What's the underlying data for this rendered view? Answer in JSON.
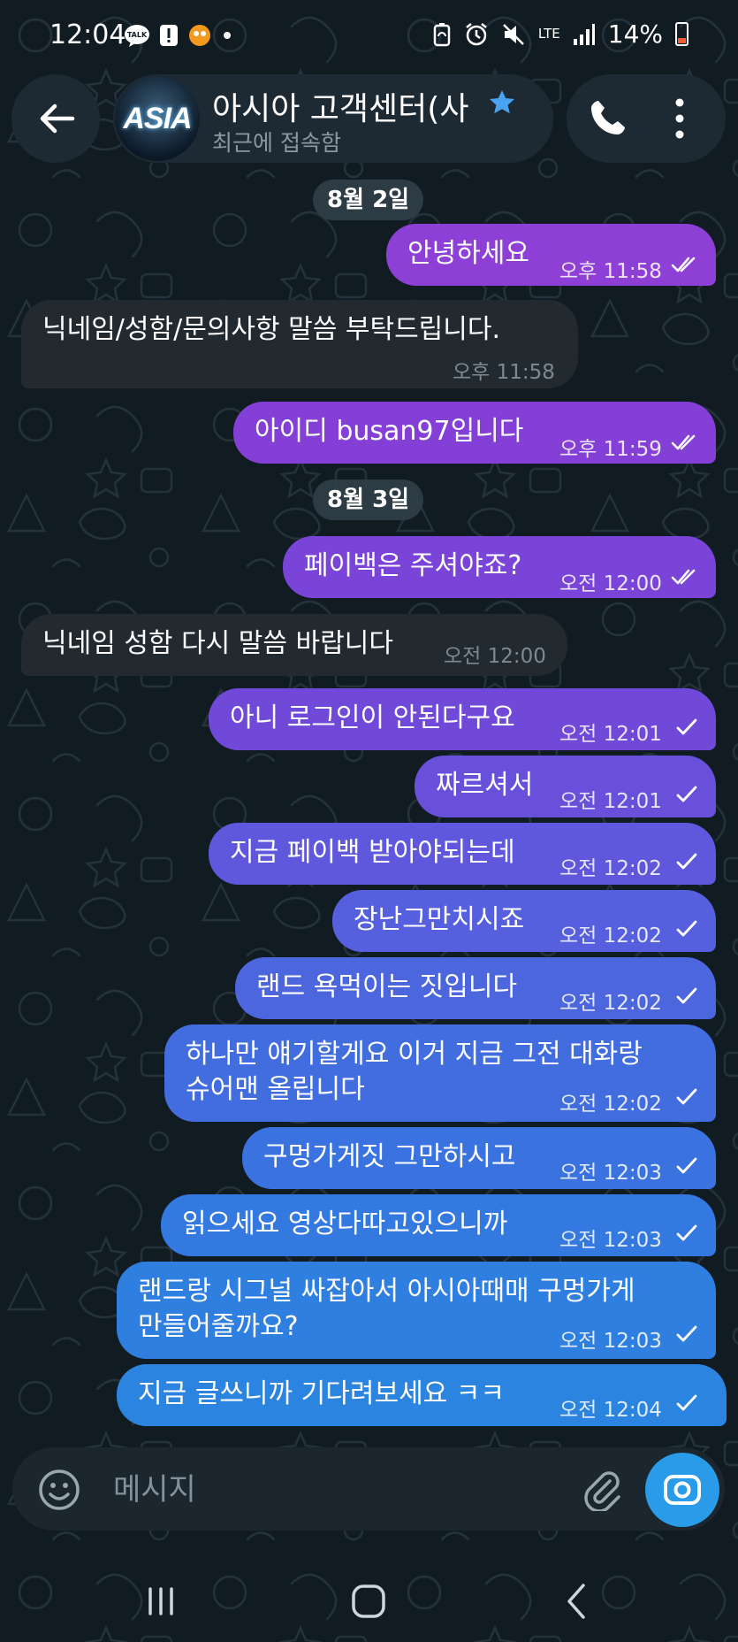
{
  "status_bar": {
    "time": "12:04",
    "network": "LTE",
    "battery": "14%"
  },
  "header": {
    "title": "아시아 고객센터(사",
    "status": "최근에 접속함",
    "avatar_text": "ASIA"
  },
  "colors": {
    "background": "#111b22",
    "incoming_bubble": "#222a30",
    "outgoing_purple": "#8e3fd6",
    "outgoing_blue": "#2f7fe0",
    "accent": "#2a9be8"
  },
  "dates": [
    "8월 2일",
    "8월 3일"
  ],
  "messages": [
    {
      "dir": "out",
      "text": "안녕하세요",
      "time": "오후 11:58",
      "status": "read"
    },
    {
      "dir": "in",
      "text": "닉네임/성함/문의사항 말씀 부탁드립니다.",
      "time": "오후 11:58"
    },
    {
      "dir": "out",
      "text": "아이디 busan97입니다",
      "time": "오후 11:59",
      "status": "read"
    },
    {
      "dir": "out",
      "text": "페이백은 주셔야죠?",
      "time": "오전 12:00",
      "status": "read"
    },
    {
      "dir": "in",
      "text": "닉네임 성함 다시 말씀 바랍니다",
      "time": "오전 12:00"
    },
    {
      "dir": "out",
      "text": "아니 로그인이 안된다구요",
      "time": "오전 12:01",
      "status": "sent"
    },
    {
      "dir": "out",
      "text": "짜르셔서",
      "time": "오전 12:01",
      "status": "sent"
    },
    {
      "dir": "out",
      "text": "지금 페이백 받아야되는데",
      "time": "오전 12:02",
      "status": "sent"
    },
    {
      "dir": "out",
      "text": "장난그만치시죠",
      "time": "오전 12:02",
      "status": "sent"
    },
    {
      "dir": "out",
      "text": "랜드 욕먹이는 짓입니다",
      "time": "오전 12:02",
      "status": "sent"
    },
    {
      "dir": "out",
      "lines": [
        "하나만 얘기할게요 이거 지금 그전 대화랑",
        "슈어맨 올립니다"
      ],
      "time": "오전 12:02",
      "status": "sent"
    },
    {
      "dir": "out",
      "text": "구멍가게짓 그만하시고",
      "time": "오전 12:03",
      "status": "sent"
    },
    {
      "dir": "out",
      "text": "읽으세요 영상다따고있으니까",
      "time": "오전 12:03",
      "status": "sent"
    },
    {
      "dir": "out",
      "lines": [
        "랜드랑 시그널 싸잡아서 아시아때매 구멍가게",
        "만들어줄까요?"
      ],
      "time": "오전 12:03",
      "status": "sent"
    },
    {
      "dir": "out",
      "text": "지금 글쓰니까 기다려보세요 ㅋㅋ",
      "time": "오전 12:04",
      "status": "sent"
    }
  ],
  "input": {
    "placeholder": "메시지"
  },
  "icons": {
    "header": [
      "back-arrow-icon",
      "star-icon",
      "call-icon",
      "more-vertical-icon"
    ],
    "input": [
      "emoji-icon",
      "paperclip-icon",
      "camera-icon"
    ],
    "nav": [
      "recents-icon",
      "home-icon",
      "back-nav-icon"
    ]
  }
}
